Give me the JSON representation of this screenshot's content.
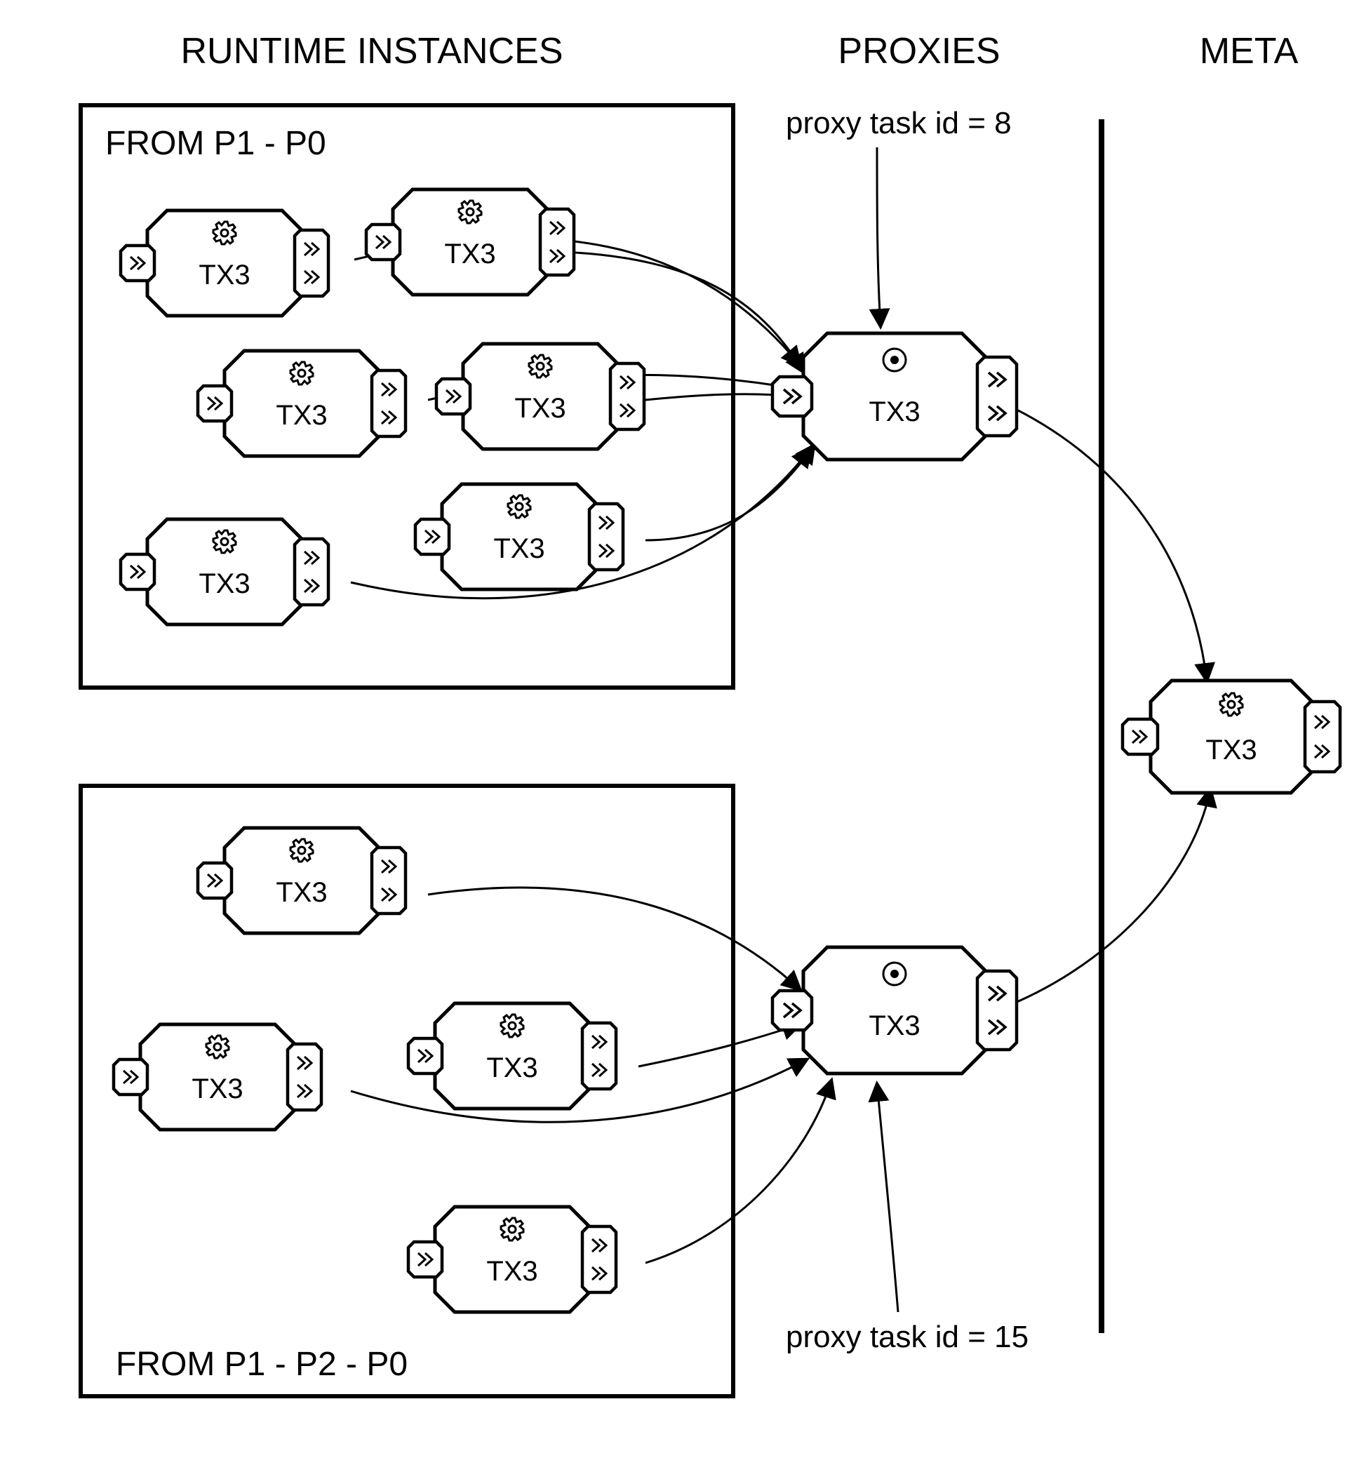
{
  "columns": {
    "runtime": "RUNTIME INSTANCES",
    "proxies": "PROXIES",
    "meta": "META"
  },
  "groups": {
    "top": {
      "label": "FROM P1 - P0"
    },
    "bottom": {
      "label": "FROM P1 - P2 - P0"
    }
  },
  "proxyAnnotations": {
    "top": "proxy task id = 8",
    "bottom": "proxy task id = 15"
  },
  "nodes": {
    "runtime_top": [
      {
        "label": "TX3"
      },
      {
        "label": "TX3"
      },
      {
        "label": "TX3"
      },
      {
        "label": "TX3"
      },
      {
        "label": "TX3"
      },
      {
        "label": "TX3"
      }
    ],
    "runtime_bottom": [
      {
        "label": "TX3"
      },
      {
        "label": "TX3"
      },
      {
        "label": "TX3"
      },
      {
        "label": "TX3"
      }
    ],
    "proxy_top": {
      "label": "TX3"
    },
    "proxy_bottom": {
      "label": "TX3"
    },
    "meta": {
      "label": "TX3"
    }
  }
}
